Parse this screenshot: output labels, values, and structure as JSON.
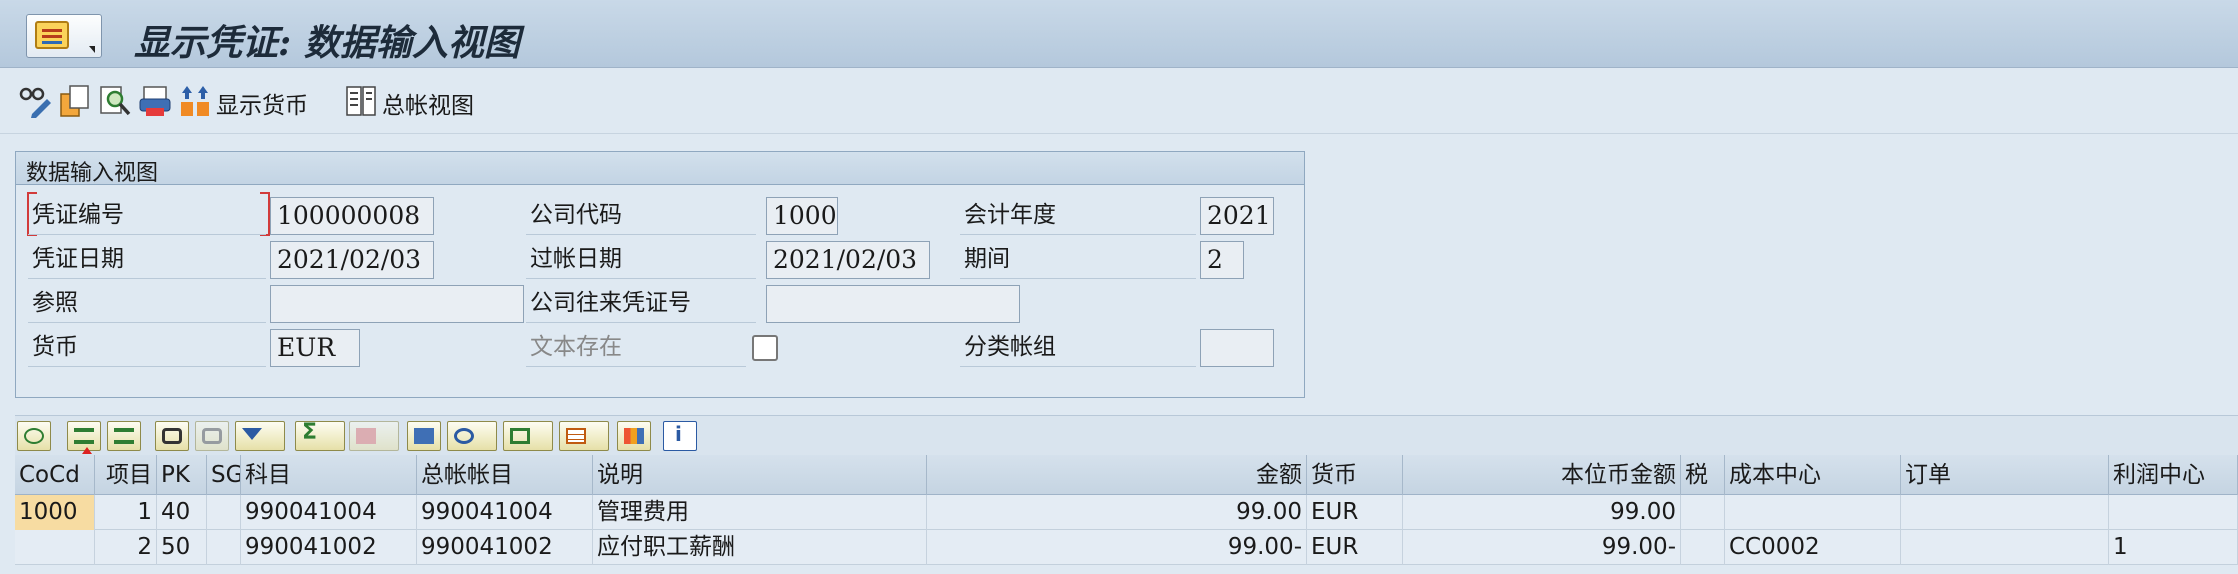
{
  "window": {
    "title": "显示凭证: 数据输入视图"
  },
  "app_toolbar": {
    "show_currency_label": "显示货币",
    "gl_view_label": "总帐视图",
    "icons": [
      "glasses-pencil-icon",
      "document-copy-icon",
      "search-document-icon",
      "print-icon",
      "distribute-icon",
      "ledger-icon"
    ]
  },
  "panel": {
    "title": "数据输入视图",
    "fields": {
      "doc_number": {
        "label": "凭证编号",
        "value": "100000008"
      },
      "company_code": {
        "label": "公司代码",
        "value": "1000"
      },
      "fiscal_year": {
        "label": "会计年度",
        "value": "2021"
      },
      "doc_date": {
        "label": "凭证日期",
        "value": "2021/02/03"
      },
      "posting_date": {
        "label": "过帐日期",
        "value": "2021/02/03"
      },
      "period": {
        "label": "期间",
        "value": "2"
      },
      "reference": {
        "label": "参照",
        "value": ""
      },
      "intercompany": {
        "label": "公司往来凭证号",
        "value": ""
      },
      "currency": {
        "label": "货币",
        "value": "EUR"
      },
      "text_exists": {
        "label": "文本存在",
        "checked": false
      },
      "ledger_group": {
        "label": "分类帐组",
        "value": ""
      }
    }
  },
  "grid_toolbar": {
    "icons": [
      "details-icon",
      "align-top-icon",
      "align-bottom-icon",
      "find-icon",
      "find-next-icon",
      "filter-icon",
      "sum-icon",
      "subtotal-icon",
      "print-preview-icon",
      "view-icon",
      "export-icon",
      "layout-icon",
      "chart-icon",
      "info-icon"
    ]
  },
  "table": {
    "columns": [
      "CoCd",
      "项目",
      "PK",
      "SG",
      "科目",
      "总帐帐目",
      "说明",
      "金额",
      "货币",
      "本位币金额",
      "税",
      "成本中心",
      "订单",
      "利润中心"
    ],
    "rows": [
      {
        "cocd": "1000",
        "item": "1",
        "pk": "40",
        "sg": "",
        "account": "990041004",
        "gl_account": "990041004",
        "text": "管理费用",
        "amount": "99.00",
        "currency": "EUR",
        "local_amount": "99.00",
        "tax": "",
        "cost_center": "",
        "order": "",
        "profit_center": ""
      },
      {
        "cocd": "",
        "item": "2",
        "pk": "50",
        "sg": "",
        "account": "990041002",
        "gl_account": "990041002",
        "text": "应付职工薪酬",
        "amount": "99.00-",
        "currency": "EUR",
        "local_amount": "99.00-",
        "tax": "",
        "cost_center": "CC0002",
        "order": "",
        "profit_center": "1"
      }
    ]
  }
}
